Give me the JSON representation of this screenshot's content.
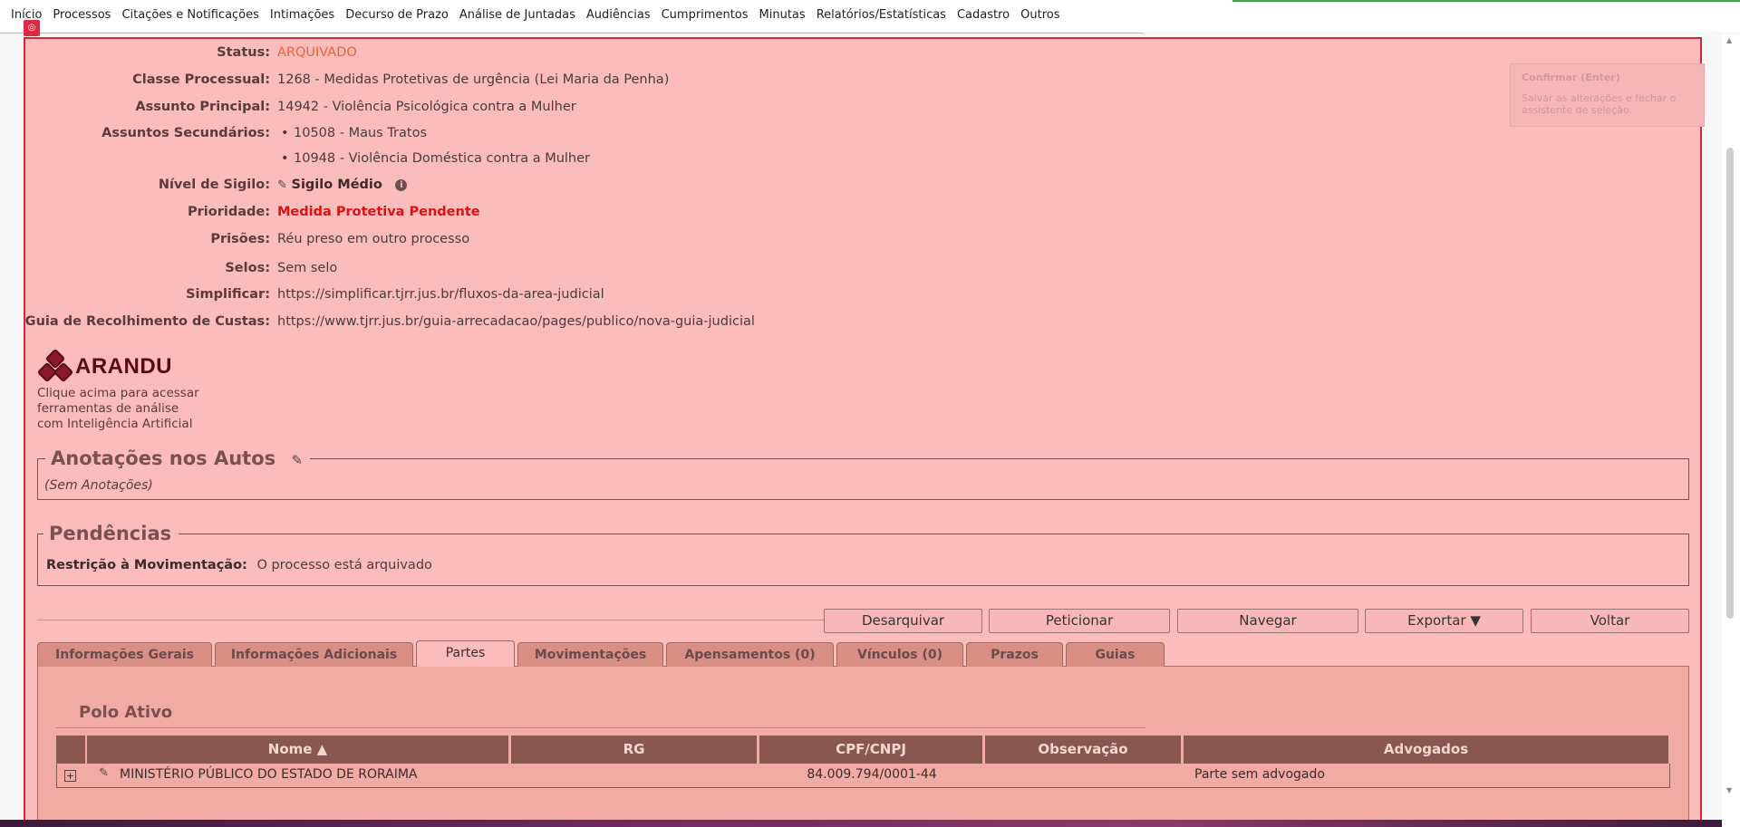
{
  "menu": [
    "Início",
    "Processos",
    "Citações e Notificações",
    "Intimações",
    "Decurso de Prazo",
    "Análise de Juntadas",
    "Audiências",
    "Cumprimentos",
    "Minutas",
    "Relatórios/Estatísticas",
    "Cadastro",
    "Outros"
  ],
  "tooltip": {
    "title": "Confirmar (Enter)",
    "text": "Salvar as alterações e fechar o assistente de seleção."
  },
  "fields": {
    "status": {
      "label": "Status:",
      "value": "ARQUIVADO"
    },
    "classe": {
      "label": "Classe Processual:",
      "value": "1268 - Medidas Protetivas de urgência (Lei Maria da Penha)"
    },
    "assunto": {
      "label": "Assunto Principal:",
      "value": "14942 - Violência Psicológica contra a Mulher"
    },
    "secundarios": {
      "label": "Assuntos Secundários:",
      "items": [
        "10508 - Maus Tratos",
        "10948 - Violência Doméstica contra a Mulher"
      ]
    },
    "sigilo": {
      "label": "Nível de Sigilo:",
      "value": "Sigilo Médio"
    },
    "prioridade": {
      "label": "Prioridade:",
      "value": "Medida Protetiva Pendente"
    },
    "prisoes": {
      "label": "Prisões:",
      "value": "Réu preso em outro processo"
    },
    "selos": {
      "label": "Selos:",
      "value": "Sem selo"
    },
    "simplificar": {
      "label": "Simplificar:",
      "value": "https://simplificar.tjrr.jus.br/fluxos-da-area-judicial"
    },
    "guia": {
      "label": "Guia de Recolhimento de Custas:",
      "value": "https://www.tjrr.jus.br/guia-arrecadacao/pages/publico/nova-guia-judicial"
    }
  },
  "arandu": {
    "brand": "ARANDU",
    "caption": [
      "Clique acima para acessar",
      "ferramentas de análise",
      "com Inteligência Artificial"
    ]
  },
  "anotacoes": {
    "title": "Anotações nos Autos",
    "empty": "(Sem Anotações)"
  },
  "pendencias": {
    "title": "Pendências",
    "label": "Restrição à Movimentação:",
    "value": "O processo está arquivado"
  },
  "buttons": {
    "desarquivar": "Desarquivar",
    "peticionar": "Peticionar",
    "navegar": "Navegar",
    "exportar": "Exportar ▼",
    "voltar": "Voltar"
  },
  "tabs": [
    "Informações Gerais",
    "Informações Adicionais",
    "Partes",
    "Movimentações",
    "Apensamentos (0)",
    "Vínculos (0)",
    "Prazos",
    "Guias"
  ],
  "active_tab": "Partes",
  "polo": {
    "title": "Polo Ativo"
  },
  "table": {
    "headers": [
      "Nome ▲",
      "RG",
      "CPF/CNPJ",
      "Observação",
      "Advogados"
    ],
    "rows": [
      {
        "nome": "MINISTÉRIO PÚBLICO DO ESTADO DE RORAIMA",
        "rg": "",
        "cpf": "84.009.794/0001-44",
        "obs": "",
        "adv": "Parte sem advogado"
      }
    ]
  }
}
